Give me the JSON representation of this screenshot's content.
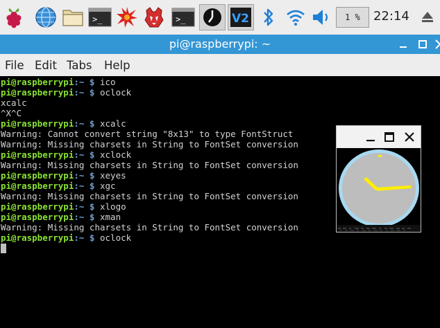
{
  "panel": {
    "icons": [
      "raspberry-menu-icon",
      "web-browser-icon",
      "file-manager-icon",
      "terminal-icon",
      "burst-app-icon",
      "wolfram-icon",
      "terminal-icon",
      "oclock-icon",
      "vnc-icon",
      "bluetooth-icon",
      "wifi-icon",
      "volume-icon",
      "eject-icon"
    ],
    "cpu_usage": "1 %",
    "clock": "22:14"
  },
  "window": {
    "title": "pi@raspberrypi: ~"
  },
  "menu": {
    "file": "File",
    "edit": "Edit",
    "tabs": "Tabs",
    "help": "Help"
  },
  "terminal": {
    "prompt_user": "pi@raspberrypi",
    "prompt_path": ":~ $ ",
    "lines": [
      {
        "type": "cmd",
        "text": "ico"
      },
      {
        "type": "cmd",
        "text": "oclock"
      },
      {
        "type": "out",
        "text": "xcalc"
      },
      {
        "type": "out",
        "text": "^X^C"
      },
      {
        "type": "cmd",
        "text": "xcalc"
      },
      {
        "type": "out",
        "text": "Warning: Cannot convert string \"8x13\" to type FontStruct"
      },
      {
        "type": "out",
        "text": "Warning: Missing charsets in String to FontSet conversion"
      },
      {
        "type": "cmd",
        "text": "xclock"
      },
      {
        "type": "out",
        "text": "Warning: Missing charsets in String to FontSet conversion"
      },
      {
        "type": "cmd",
        "text": "xeyes"
      },
      {
        "type": "cmd",
        "text": "xgc"
      },
      {
        "type": "out",
        "text": "Warning: Missing charsets in String to FontSet conversion"
      },
      {
        "type": "cmd",
        "text": "xlogo"
      },
      {
        "type": "cmd",
        "text": "xman"
      },
      {
        "type": "out",
        "text": "Warning: Missing charsets in String to FontSet conversion"
      },
      {
        "type": "cmd",
        "text": "oclock"
      }
    ]
  },
  "colors": {
    "titlebar": "#3396d5",
    "panel": "#ededed",
    "prompt_user": "#8ae234",
    "prompt_path": "#729fcf",
    "clock_face": "#bdbdbd",
    "clock_rim": "#a8d8f0",
    "clock_hands": "#ffee00"
  }
}
